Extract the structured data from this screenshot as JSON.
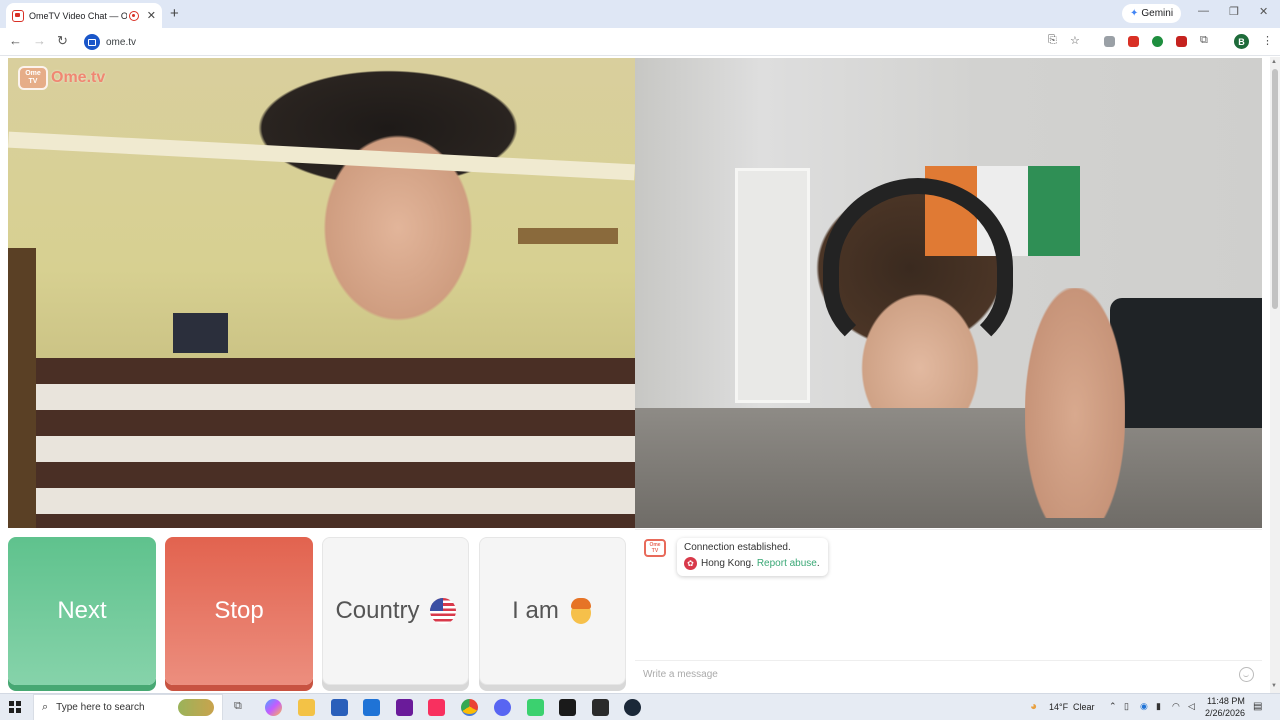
{
  "browser": {
    "tab_title": "OmeTV Video Chat — Ome",
    "tab_close": "✕",
    "new_tab": "+",
    "gemini_label": "Gemini",
    "url": "ome.tv",
    "profile_initial": "B",
    "window_controls": [
      "—",
      "❐",
      "✕"
    ]
  },
  "site": {
    "logo_box": "Ome TV",
    "logo_text": "Ome.tv"
  },
  "controls": {
    "next_label": "Next",
    "stop_label": "Stop",
    "country_label": "Country",
    "iam_label": "I am"
  },
  "chat": {
    "logo_label": "Ome TV",
    "status_line": "Connection established.",
    "location": "Hong Kong.",
    "report_link": "Report abuse",
    "report_suffix": ".",
    "message_placeholder": "Write a message"
  },
  "taskbar": {
    "search_placeholder": "Type here to search",
    "temperature": "14°F",
    "weather": "Clear",
    "time": "11:48 PM",
    "date": "2/26/2026"
  },
  "colors": {
    "next_green": "#5fc28d",
    "stop_red": "#e2634f",
    "link_green": "#3aa876"
  }
}
